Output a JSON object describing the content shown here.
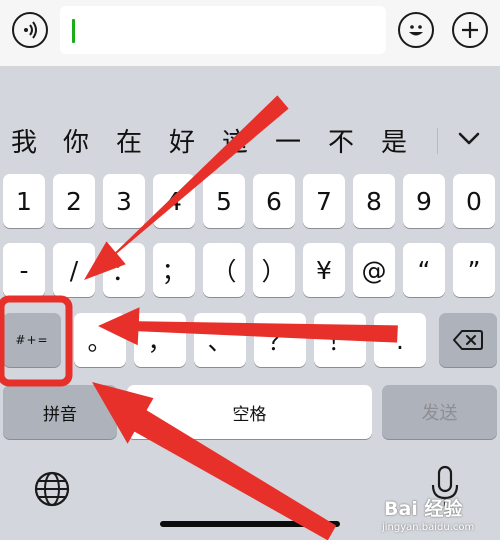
{
  "input_bar": {
    "voice_icon": "voice-icon",
    "emoji_icon": "emoji-icon",
    "plus_icon": "plus-icon",
    "text_value": ""
  },
  "candidates": {
    "items": [
      "我",
      "你",
      "在",
      "好",
      "这",
      "一",
      "不",
      "是"
    ],
    "expand_icon": "chevron-down-icon"
  },
  "keyboard": {
    "row1": [
      "1",
      "2",
      "3",
      "4",
      "5",
      "6",
      "7",
      "8",
      "9",
      "0"
    ],
    "row2": [
      "-",
      "/",
      "：",
      "；",
      "（",
      "）",
      "¥",
      "@",
      "“",
      "”"
    ],
    "row3": [
      "。",
      "，",
      "、",
      "？",
      "！",
      "."
    ],
    "symbols_key": "#+=",
    "backspace_icon": "backspace-icon",
    "pinyin_key": "拼音",
    "space_key": "空格",
    "send_key": "发送",
    "globe_icon": "globe-icon",
    "mic_icon": "microphone-icon"
  },
  "watermark": {
    "main": "Bai 经验",
    "sub": "jingyan.baidu.com"
  },
  "colors": {
    "keyboard_bg": "#d3d6dc",
    "annotation_red": "#e8302a",
    "cursor_green": "#1aad19"
  }
}
